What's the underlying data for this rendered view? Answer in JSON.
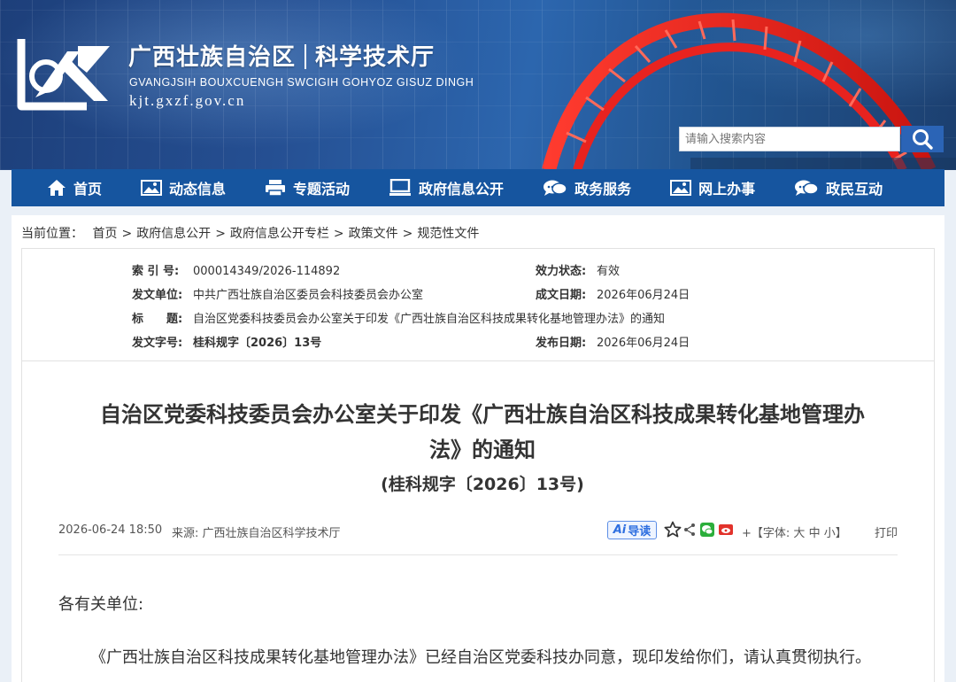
{
  "header": {
    "org_name": "广西壮族自治区",
    "dept_name": "科学技术厅",
    "english_name": "GVANGJSIH BOUXCUENGH SWCIGIH GOHYOZ GISUZ DINGH",
    "domain": "kjt.gxzf.gov.cn",
    "logo_icon": "kj-logo-icon",
    "search_placeholder": "请输入搜索内容",
    "search_icon": "search-icon"
  },
  "nav": {
    "items": [
      {
        "label": "首页",
        "icon": "home-icon"
      },
      {
        "label": "动态信息",
        "icon": "image-icon"
      },
      {
        "label": "专题活动",
        "icon": "printer-icon"
      },
      {
        "label": "政府信息公开",
        "icon": "monitor-icon"
      },
      {
        "label": "政务服务",
        "icon": "chat-icon"
      },
      {
        "label": "网上办事",
        "icon": "image-icon"
      },
      {
        "label": "政民互动",
        "icon": "chat-icon"
      }
    ]
  },
  "breadcrumb": {
    "prefix": "当前位置：",
    "items": [
      "首页",
      "政府信息公开",
      "政府信息公开专栏",
      "政策文件",
      "规范性文件"
    ],
    "separator": ">"
  },
  "meta": {
    "index_label": "索 引 号:",
    "index_value": "000014349/2026-114892",
    "issuer_label": "发文单位:",
    "issuer_value": "中共广西壮族自治区委员会科技委员会办公室",
    "title_label": "标　　题:",
    "title_value": "自治区党委科技委员会办公室关于印发《广西壮族自治区科技成果转化基地管理办法》的通知",
    "docno_label": "发文字号:",
    "docno_value": "桂科规字〔2026〕13号",
    "status_label": "效力状态:",
    "status_value": "有效",
    "created_label": "成文日期:",
    "created_value": "2026年06月24日",
    "published_label": "发布日期:",
    "published_value": "2026年06月24日"
  },
  "article": {
    "title_line1": "自治区党委科技委员会办公室关于印发《广西壮族自治区科技成果转化基地管理办",
    "title_line2": "法》的通知",
    "subtitle": "(桂科规字〔2026〕13号)",
    "datetime": "2026-06-24 18:50",
    "source": "来源:  广西壮族自治区科学技术厅",
    "ai_label": "导读",
    "ai_prefix": "Ai",
    "font_prefix": "+【字体:",
    "font_large": "大",
    "font_medium": "中",
    "font_small": "小",
    "font_suffix": "】",
    "print_label": "打印",
    "greeting": "各有关单位:",
    "paragraph": "《广西壮族自治区科技成果转化基地管理办法》已经自治区党委科技办同意，现印发给你们，请认真贯彻执行。",
    "tools": [
      "star-icon",
      "share-icon",
      "wechat-icon",
      "weibo-icon"
    ]
  },
  "colors": {
    "nav_bg": "#16559f",
    "banner_bg": "#254f92",
    "bridge_red": "#e8231f",
    "ai_blue": "#2e6fe0"
  }
}
